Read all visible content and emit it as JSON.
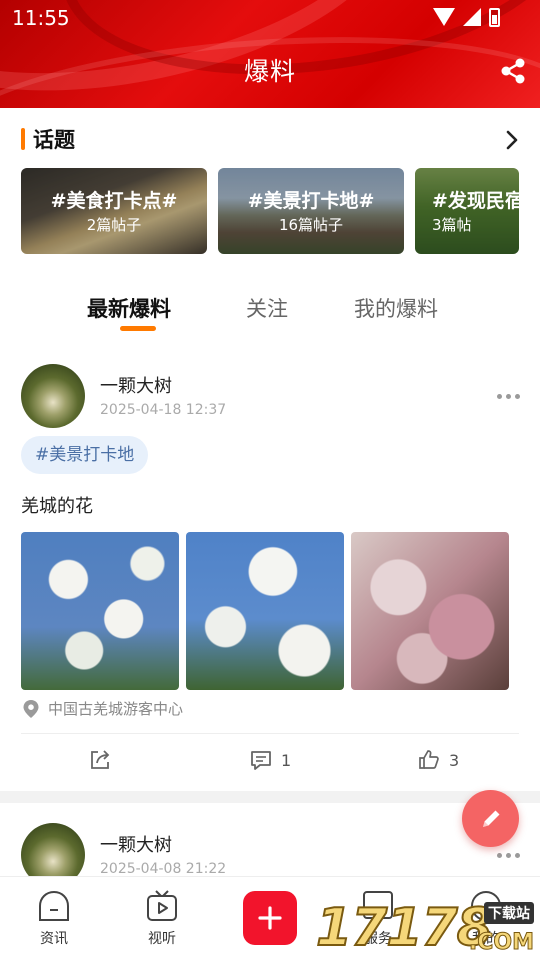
{
  "status_bar": {
    "time": "11:55"
  },
  "header": {
    "title": "爆料"
  },
  "topics": {
    "title": "话题",
    "cards": [
      {
        "name": "#美食打卡点#",
        "count": "2篇帖子"
      },
      {
        "name": "#美景打卡地#",
        "count": "16篇帖子"
      },
      {
        "name": "#发现民宿",
        "count": "3篇帖"
      }
    ]
  },
  "tabs": [
    {
      "label": "最新爆料",
      "active": true
    },
    {
      "label": "关注",
      "active": false
    },
    {
      "label": "我的爆料",
      "active": false
    }
  ],
  "posts": [
    {
      "author": "一颗大树",
      "time": "2025-04-18 12:37",
      "tag": "#美景打卡地",
      "text": "羌城的花",
      "location": "中国古羌城游客中心",
      "comment_count": "1",
      "like_count": "3"
    },
    {
      "author": "一颗大树",
      "time": "2025-04-08 21:22"
    }
  ],
  "bottom_nav": [
    {
      "label": "资讯"
    },
    {
      "label": "视听"
    },
    {
      "label": "服务"
    },
    {
      "label": "我的"
    }
  ],
  "watermark": {
    "number": "17178",
    "site": "下载站",
    "suffix": ".COM"
  },
  "colors": {
    "brand_red": "#e40d0d",
    "accent_orange": "#ff7a00",
    "fab": "#f46464",
    "add_button": "#f2142c",
    "tag_bg": "#e7f0fb"
  }
}
